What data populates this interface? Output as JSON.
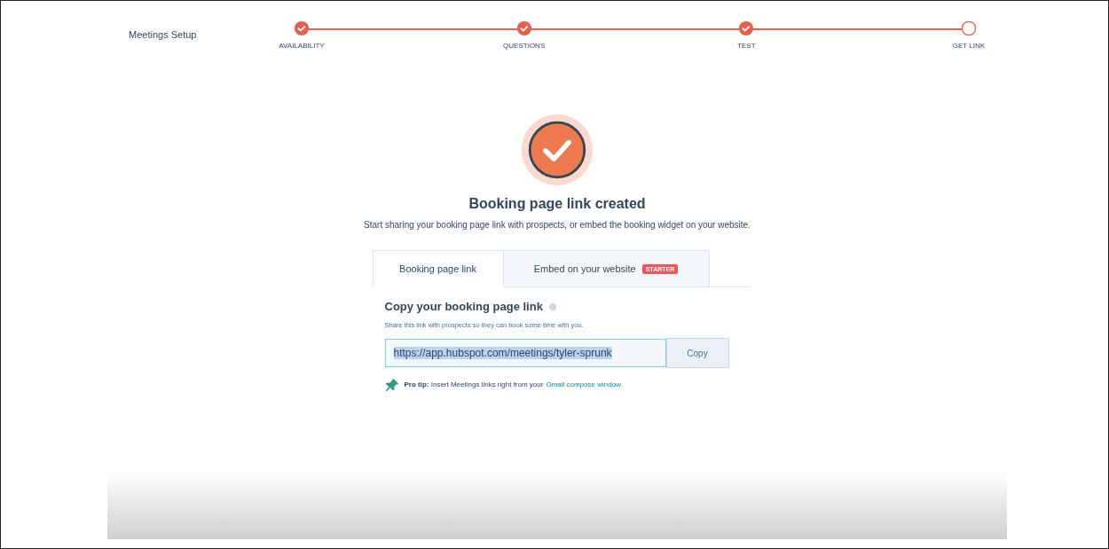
{
  "header": {
    "title": "Meetings Setup"
  },
  "steps": [
    {
      "label": "AVAILABILITY",
      "done": true
    },
    {
      "label": "QUESTIONS",
      "done": true
    },
    {
      "label": "TEST",
      "done": true
    },
    {
      "label": "GET LINK",
      "done": false
    }
  ],
  "success": {
    "title": "Booking page link created",
    "text": "Start sharing your booking page link with prospects, or embed the booking widget on your website."
  },
  "tabs": [
    {
      "label": "Booking page link",
      "selected": true
    },
    {
      "label": "Embed on your website",
      "selected": false,
      "badge": "STARTER"
    }
  ],
  "panel": {
    "heading": "Copy your booking page link",
    "description": "Share this link with prospects so they can book some time with you.",
    "url": {
      "value": "https://app.hubspot.com/meetings/tyler-sprunk",
      "highlighted": true
    },
    "copy_button": "Copy",
    "tip": {
      "text": "**Pro tip:** Insert Meetings links right from your",
      "link": "Gmail compose window",
      "tail": "."
    }
  }
}
